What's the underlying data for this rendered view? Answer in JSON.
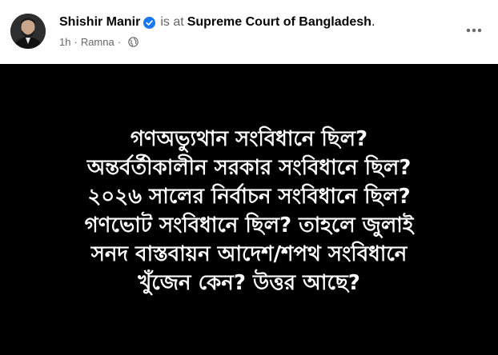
{
  "post": {
    "author_name": "Shishir Manir",
    "is_at_text": "is at",
    "place_name": "Supreme Court of Bangladesh",
    "place_suffix": ".",
    "time": "1h",
    "separator": "·",
    "location": "Ramna",
    "audience_icon": "globe-icon",
    "verified_icon": "verified-badge-icon",
    "more_icon": "more-options-icon",
    "verified_color": "#1877f2"
  },
  "media": {
    "background": "#000000",
    "lines": [
      "গণঅভ্যুথান সংবিধানে ছিল?",
      "অন্তর্বর্তীকালীন সরকার সংবিধানে ছিল?",
      "২০২৬ সালের নির্বাচন সংবিধানে ছিল?",
      "গণভোট সংবিধানে ছিল? তাহলে জুলাই",
      "সনদ বাস্তবায়ন আদেশ/শপথ সংবিধানে",
      "খুঁজেন কেন? উত্তর আছে?"
    ]
  }
}
